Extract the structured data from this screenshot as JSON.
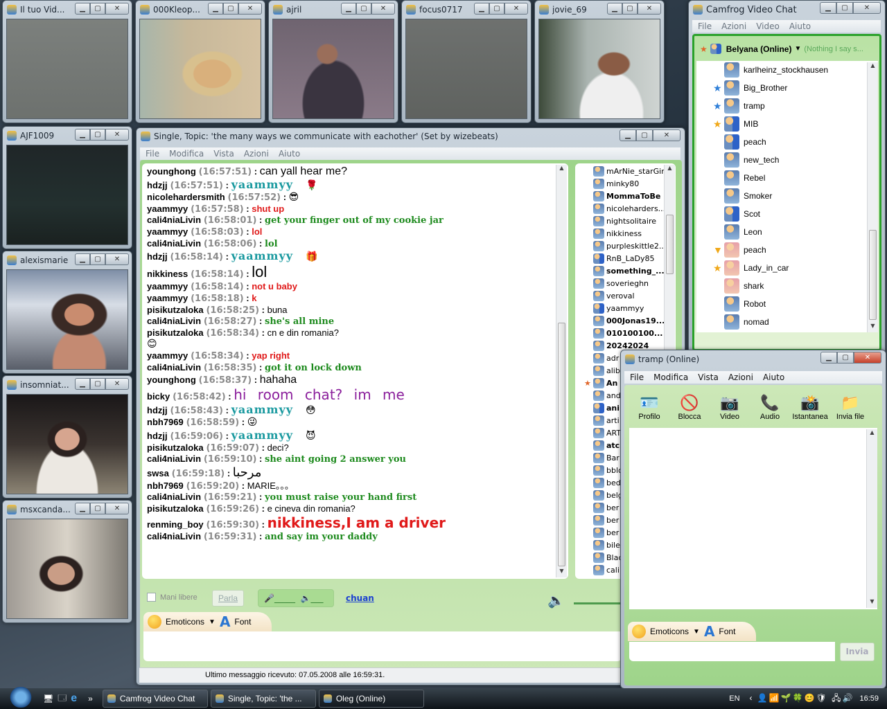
{
  "colors": {
    "accent_green": "#8fcf79",
    "name_teal": "#1b9aa0",
    "red": "#e01919",
    "green": "#1d8a1d",
    "purple": "#8b1f9c",
    "link": "#1a3fd0"
  },
  "video_windows": [
    {
      "title": "Il tuo Vid...",
      "feed": "linear-gradient(#7c807d,#6d716e)"
    },
    {
      "title": "000Kleop...",
      "feed": "radial-gradient(ellipse at 60% 55%,#d9b07c 0 18%,#d8c08e 19% 28%,transparent 30%),linear-gradient(90deg,#a7b6ab,#c7b89a 40%,#d5c2a2)"
    },
    {
      "title": "ajril",
      "feed": "radial-gradient(ellipse at 45% 35%,#9a6e5a 0 10%,transparent 12%),radial-gradient(ellipse at 50% 85%,#3a3440 0 35%,transparent 37%),linear-gradient(#6f6470,#8a7a88)"
    },
    {
      "title": "focus0717",
      "feed": "linear-gradient(#6e716f,#5f625f)"
    },
    {
      "title": "jovie_69",
      "feed": "radial-gradient(ellipse at 62% 45%,#8a5c45 0 14%,transparent 16%),radial-gradient(ellipse at 60% 95%,#efefef 0 30%,transparent 32%),linear-gradient(90deg,#3d4a3a,#aab4b0 40%,#cfd4d2)"
    },
    {
      "title": "AJF1009",
      "feed": "linear-gradient(#1f2628,#23302f 60%,#1a2120)"
    },
    {
      "title": "alexismarie",
      "feed": "radial-gradient(ellipse at 60% 45%,#c98c6f 0 14%,#3a2a25 15% 26%,transparent 28%),radial-gradient(ellipse at 60% 95%,#c48a72 0 25%,transparent 27%),linear-gradient(#7e8ea6,#d7dde6 35%,#5a5f6a)"
    },
    {
      "title": "insomniat...",
      "feed": "radial-gradient(ellipse at 50% 45%,#d6a58f 0 14%,#2b211f 15% 22%,transparent 24%),radial-gradient(ellipse at 50% 100%,#ece8e2 0 35%,transparent 37%),linear-gradient(#1a1718,#3b3430 50%,#8c8474)"
    },
    {
      "title": "msxcanda...",
      "feed": "radial-gradient(ellipse at 45% 55%,#c99d86 0 14%,#2b211f 15% 22%,transparent 24%),linear-gradient(90deg,#9f9a94,#d9d3c8 50%,#7d7972)"
    }
  ],
  "chat_window": {
    "title": "Single, Topic: 'the many ways we communicate with eachother' (Set by wizebeats)",
    "menu": [
      "File",
      "Modifica",
      "Vista",
      "Azioni",
      "Aiuto"
    ],
    "messages": [
      {
        "user": "younghong",
        "time": "(16:57:51)",
        "text": "can yall hear me?",
        "style": "big"
      },
      {
        "user": "hdzjj",
        "time": "(16:57:51)",
        "text": "yaammyy",
        "style": "teal",
        "emoji": "🌹"
      },
      {
        "user": "nicolehardersmith",
        "time": "(16:57:52)",
        "text": "",
        "style": "plain",
        "emoji": "😎"
      },
      {
        "user": "yaammyy",
        "time": "(16:57:58)",
        "text": "shut up",
        "style": "red"
      },
      {
        "user": "cali4niaLivin",
        "time": "(16:58:01)",
        "text": "get your finger out of my cookie jar",
        "style": "green"
      },
      {
        "user": "yaammyy",
        "time": "(16:58:03)",
        "text": "lol",
        "style": "red"
      },
      {
        "user": "cali4niaLivin",
        "time": "(16:58:06)",
        "text": "lol",
        "style": "green"
      },
      {
        "user": "hdzjj",
        "time": "(16:58:14)",
        "text": "yaammyy",
        "style": "teal",
        "emoji": "🎁"
      },
      {
        "user": "nikkiness",
        "time": "(16:58:14)",
        "text": "lol",
        "style": "huge"
      },
      {
        "user": "yaammyy",
        "time": "(16:58:14)",
        "text": "not u baby",
        "style": "red"
      },
      {
        "user": "yaammyy",
        "time": "(16:58:18)",
        "text": "k",
        "style": "red"
      },
      {
        "user": "pisikutzaloka",
        "time": "(16:58:25)",
        "text": "buna",
        "style": "plain"
      },
      {
        "user": "cali4niaLivin",
        "time": "(16:58:27)",
        "text": "she's all mine",
        "style": "green"
      },
      {
        "user": "pisikutzaloka",
        "time": "(16:58:34)",
        "text": "cn e din romania?",
        "style": "plain",
        "emoji_line": "😊"
      },
      {
        "user": "yaammyy",
        "time": "(16:58:34)",
        "text": "yap right",
        "style": "red"
      },
      {
        "user": "cali4niaLivin",
        "time": "(16:58:35)",
        "text": "got it on lock down",
        "style": "green"
      },
      {
        "user": "younghong",
        "time": "(16:58:37)",
        "text": "hahaha",
        "style": "big"
      },
      {
        "user": "bicky",
        "time": "(16:58:42)",
        "text": "hi  room   chat?  im me",
        "style": "purple"
      },
      {
        "user": "hdzjj",
        "time": "(16:58:43)",
        "text": "yaammyy",
        "style": "teal",
        "emoji": "😳"
      },
      {
        "user": "nbh7969",
        "time": "(16:58:59)",
        "text": "",
        "style": "plain",
        "emoji": "😜"
      },
      {
        "user": "hdzjj",
        "time": "(16:59:06)",
        "text": "yaammyy",
        "style": "teal",
        "emoji": "😈"
      },
      {
        "user": "pisikutzaloka",
        "time": "(16:59:07)",
        "text": "deci?",
        "style": "plain"
      },
      {
        "user": "cali4niaLivin",
        "time": "(16:59:10)",
        "text": "she aint going 2 answer you",
        "style": "green"
      },
      {
        "user": "swsa",
        "time": "(16:59:18)",
        "text": "مرحبا",
        "style": "arabic"
      },
      {
        "user": "nbh7969",
        "time": "(16:59:20)",
        "text": "MARIE。。。",
        "style": "plain"
      },
      {
        "user": "cali4niaLivin",
        "time": "(16:59:21)",
        "text": "you must raise your hand first",
        "style": "green"
      },
      {
        "user": "pisikutzaloka",
        "time": "(16:59:26)",
        "text": "e cineva din romania?",
        "style": "plain"
      },
      {
        "user": "renming_boy",
        "time": "(16:59:30)",
        "text": "nikkiness,I am a driver",
        "style": "redbig"
      },
      {
        "user": "cali4niaLivin",
        "time": "(16:59:31)",
        "text": "and say im your daddy",
        "style": "green"
      }
    ],
    "users": [
      {
        "name": "mArNie_starGirl",
        "icon": "c"
      },
      {
        "name": "minky80",
        "icon": "c"
      },
      {
        "name": "MommaToBe",
        "icon": "c",
        "bold": true
      },
      {
        "name": "nicoleharders...",
        "icon": "c"
      },
      {
        "name": "nightsolitaire",
        "icon": "c"
      },
      {
        "name": "nikkiness",
        "icon": "c"
      },
      {
        "name": "purpleskittle2...",
        "icon": "c"
      },
      {
        "name": "RnB_LaDy85",
        "icon": "p"
      },
      {
        "name": "something_...",
        "icon": "c",
        "bold": true
      },
      {
        "name": "soverieghn",
        "icon": "c"
      },
      {
        "name": "veroval",
        "icon": "c"
      },
      {
        "name": "yaammyy",
        "icon": "p"
      },
      {
        "name": "000Jonas19...",
        "icon": "c",
        "bold": true
      },
      {
        "name": "010100100...",
        "icon": "c",
        "bold": true
      },
      {
        "name": "20242024",
        "icon": "c",
        "bold": true
      },
      {
        "name": "adr",
        "icon": "c"
      },
      {
        "name": "alib",
        "icon": "c"
      },
      {
        "name": "An",
        "icon": "c",
        "bold": true,
        "star": "#e0662a"
      },
      {
        "name": "and",
        "icon": "c"
      },
      {
        "name": "ani",
        "icon": "p",
        "bold": true
      },
      {
        "name": "arti",
        "icon": "c"
      },
      {
        "name": "ART",
        "icon": "c"
      },
      {
        "name": "atc",
        "icon": "c",
        "bold": true
      },
      {
        "name": "Bar",
        "icon": "c"
      },
      {
        "name": "bblo",
        "icon": "c"
      },
      {
        "name": "bed",
        "icon": "c"
      },
      {
        "name": "belg",
        "icon": "c"
      },
      {
        "name": "ber",
        "icon": "c"
      },
      {
        "name": "ber",
        "icon": "c"
      },
      {
        "name": "ber",
        "icon": "c"
      },
      {
        "name": "bile",
        "icon": "c"
      },
      {
        "name": "Blac",
        "icon": "c"
      },
      {
        "name": "cali",
        "icon": "c"
      }
    ],
    "hands_free_label": "Mani libere",
    "talk_button": "Parla",
    "speaker_link": "chuan",
    "emoticons_label": "Emoticons",
    "font_label": "Font",
    "message_input": "",
    "status": "Ultimo messaggio ricevuto: 07.05.2008 alle 16:59:31."
  },
  "main_window": {
    "title": "Camfrog Video Chat",
    "menu": [
      "File",
      "Azioni",
      "Video",
      "Aiuto"
    ],
    "self_name": "Belyana (Online)",
    "self_status": "(Nothing I say s...",
    "contacts": [
      {
        "name": "karlheinz_stockhausen",
        "icon": "c"
      },
      {
        "name": "Big_Brother",
        "icon": "c",
        "star": "#2f7fd8"
      },
      {
        "name": "tramp",
        "icon": "c",
        "star": "#2f7fd8"
      },
      {
        "name": "MIB",
        "icon": "p",
        "star": "#f0a81a"
      },
      {
        "name": "peach",
        "icon": "p"
      },
      {
        "name": "new_tech",
        "icon": "c"
      },
      {
        "name": "Rebel",
        "icon": "c"
      },
      {
        "name": "Smoker",
        "icon": "c"
      },
      {
        "name": "Scot",
        "icon": "p"
      },
      {
        "name": "Leon",
        "icon": "c"
      },
      {
        "name": "peach",
        "icon": "f",
        "star": "#f0a81a",
        "star_glyph": "▼"
      },
      {
        "name": "Lady_in_car",
        "icon": "f",
        "star": "#f0a81a"
      },
      {
        "name": "shark",
        "icon": "f"
      },
      {
        "name": "Robot",
        "icon": "c"
      },
      {
        "name": "nomad",
        "icon": "c"
      }
    ]
  },
  "im_window": {
    "title": "tramp (Online)",
    "menu": [
      "File",
      "Modifica",
      "Vista",
      "Azioni",
      "Aiuto"
    ],
    "toolbar": [
      {
        "label": "Profilo",
        "icon": "profile-icon",
        "glyph": "🪪"
      },
      {
        "label": "Blocca",
        "icon": "block-icon",
        "glyph": "🚫"
      },
      {
        "label": "Video",
        "icon": "webcam-icon",
        "glyph": "📷"
      },
      {
        "label": "Audio",
        "icon": "phone-icon",
        "glyph": "📞"
      },
      {
        "label": "Istantanea",
        "icon": "camera-icon",
        "glyph": "📸"
      },
      {
        "label": "Invia file",
        "icon": "send-file-icon",
        "glyph": "📁"
      }
    ],
    "emoticons_label": "Emoticons",
    "font_label": "Font",
    "send_button": "Invia",
    "message_input": ""
  },
  "taskbar": {
    "tasks": [
      "Camfrog Video Chat",
      "Single, Topic: 'the ...",
      "Oleg (Online)"
    ],
    "language": "EN",
    "clock": "16:59"
  }
}
